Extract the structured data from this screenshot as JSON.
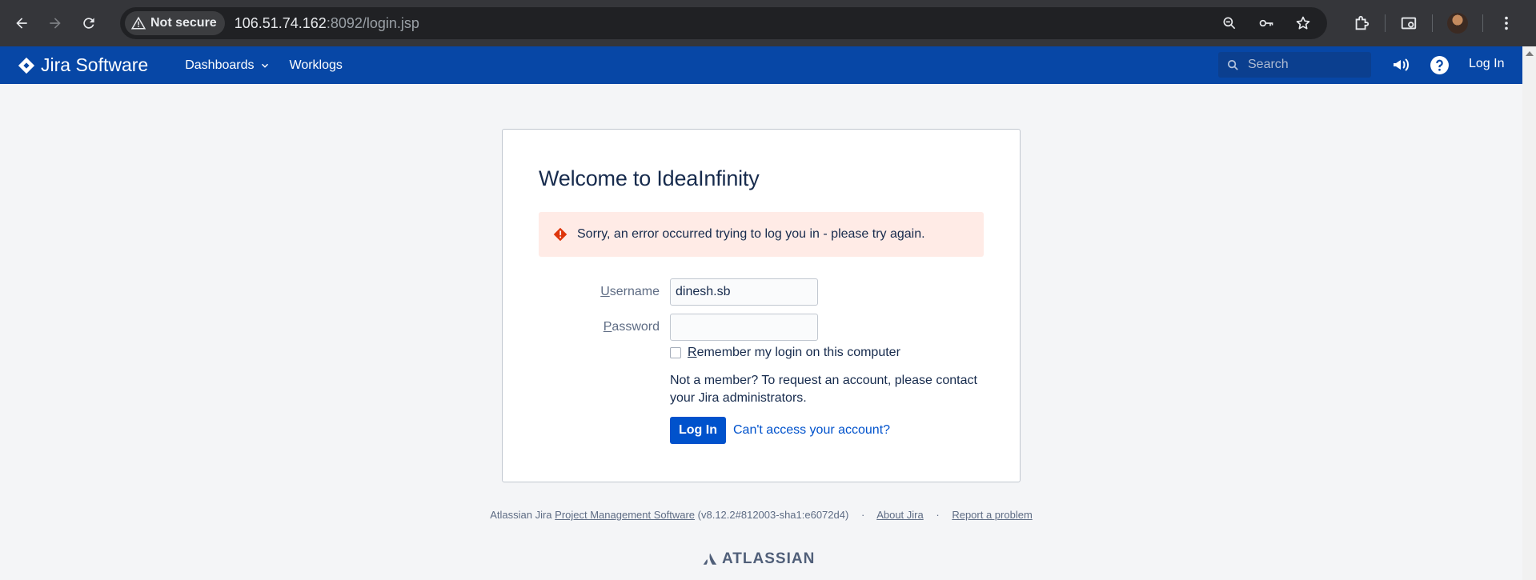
{
  "browser": {
    "security_label": "Not secure",
    "url_host": "106.51.74.162",
    "url_rest": ":8092/login.jsp"
  },
  "header": {
    "logo_text": "Jira Software",
    "nav": [
      "Dashboards",
      "Worklogs"
    ],
    "search_placeholder": "Search",
    "login_label": "Log In"
  },
  "login": {
    "title": "Welcome to IdeaInfinity",
    "error_message": "Sorry, an error occurred trying to log you in - please try again.",
    "username_label_first": "U",
    "username_label_rest": "sername",
    "username_value": "dinesh.sb",
    "password_label_first": "P",
    "password_label_rest": "assword",
    "password_value": "",
    "remember_first": "R",
    "remember_rest": "emember my login on this computer",
    "member_text": "Not a member? To request an account, please contact your Jira administrators.",
    "submit_label": "Log In",
    "cant_access": "Can't access your account?"
  },
  "footer": {
    "prefix": "Atlassian Jira",
    "pm_link": "Project Management Software",
    "version": "(v8.12.2#812003-sha1:e6072d4)",
    "about": "About Jira",
    "report": "Report a problem",
    "brand": "ATLASSIAN"
  },
  "colors": {
    "header_bg": "#0747a6",
    "primary_button": "#0052cc",
    "error_bg": "#ffebe6",
    "error_icon": "#de350b"
  }
}
